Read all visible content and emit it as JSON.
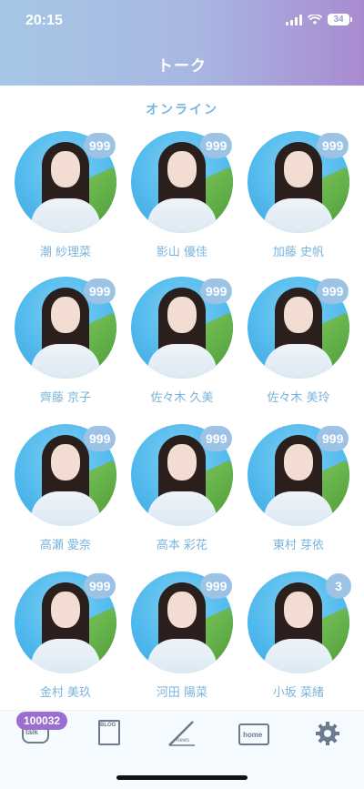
{
  "status_bar": {
    "time": "20:15",
    "battery": "34"
  },
  "header": {
    "title": "トーク"
  },
  "section": {
    "title": "オンライン"
  },
  "members": [
    {
      "name": "潮 紗理菜",
      "unread": "999"
    },
    {
      "name": "影山 優佳",
      "unread": "999"
    },
    {
      "name": "加藤 史帆",
      "unread": "999"
    },
    {
      "name": "齊藤 京子",
      "unread": "999"
    },
    {
      "name": "佐々木 久美",
      "unread": "999"
    },
    {
      "name": "佐々木 美玲",
      "unread": "999"
    },
    {
      "name": "高瀬 愛奈",
      "unread": "999"
    },
    {
      "name": "高本 彩花",
      "unread": "999"
    },
    {
      "name": "東村 芽依",
      "unread": "999"
    },
    {
      "name": "金村 美玖",
      "unread": "999"
    },
    {
      "name": "河田 陽菜",
      "unread": "999"
    },
    {
      "name": "小坂 菜緒",
      "unread": "3"
    }
  ],
  "tabbar": {
    "talk": {
      "label": "talk",
      "badge": "100032"
    },
    "blog": {
      "label": "BLOG"
    },
    "news": {
      "label": "news"
    },
    "home": {
      "label": "home"
    },
    "settings": {
      "icon": "gear-icon"
    }
  },
  "colors": {
    "header_start": "#a6c7e6",
    "header_end": "#a98ad0",
    "accent_text": "#78b7dd",
    "badge": "#9cc3e6",
    "tab_badge": "#9b6ed0"
  }
}
